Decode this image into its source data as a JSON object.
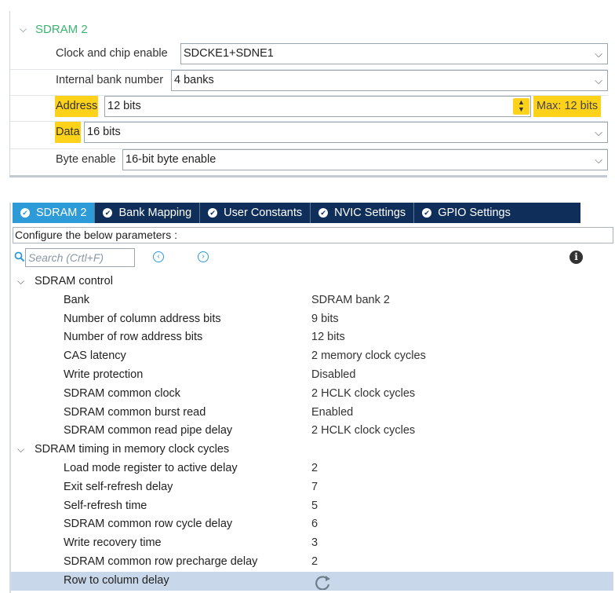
{
  "top_panel": {
    "group_title": "SDRAM 2",
    "rows": {
      "clock_chip_enable": {
        "label": "Clock and chip enable",
        "value": "SDCKE1+SDNE1"
      },
      "internal_bank_number": {
        "label": "Internal bank number",
        "value": "4 banks"
      },
      "address": {
        "label": "Address",
        "value": "12 bits",
        "max": "Max: 12 bits"
      },
      "data": {
        "label": "Data",
        "value": "16 bits"
      },
      "byte_enable": {
        "label": "Byte enable",
        "value": "16-bit byte enable"
      }
    },
    "highlight_color": "#ffd21a"
  },
  "tabs": [
    {
      "label": "SDRAM 2",
      "active": true
    },
    {
      "label": "Bank Mapping",
      "active": false
    },
    {
      "label": "User Constants",
      "active": false
    },
    {
      "label": "NVIC Settings",
      "active": false
    },
    {
      "label": "GPIO Settings",
      "active": false
    }
  ],
  "config_bar": "Configure the below parameters :",
  "search": {
    "placeholder": "Search (Crtl+F)"
  },
  "sections": {
    "control": {
      "title": "SDRAM control",
      "params": [
        {
          "name": "Bank",
          "value": "SDRAM bank 2"
        },
        {
          "name": "Number of column address bits",
          "value": "9 bits"
        },
        {
          "name": "Number of row address bits",
          "value": "12 bits"
        },
        {
          "name": "CAS latency",
          "value": "2 memory clock cycles"
        },
        {
          "name": "Write protection",
          "value": "Disabled"
        },
        {
          "name": "SDRAM common clock",
          "value": "2 HCLK clock cycles"
        },
        {
          "name": "SDRAM common burst read",
          "value": "Enabled"
        },
        {
          "name": "SDRAM common read pipe delay",
          "value": "2 HCLK clock cycles"
        }
      ]
    },
    "timing": {
      "title": "SDRAM timing in memory clock cycles",
      "params": [
        {
          "name": "Load mode register to active delay",
          "value": "2"
        },
        {
          "name": "Exit self-refresh delay",
          "value": "7"
        },
        {
          "name": "Self-refresh time",
          "value": "5"
        },
        {
          "name": "SDRAM common row cycle delay",
          "value": "6"
        },
        {
          "name": "Write recovery time",
          "value": "3"
        },
        {
          "name": "SDRAM common row precharge delay",
          "value": "2"
        },
        {
          "name": "Row to column delay",
          "value": ""
        }
      ]
    }
  },
  "colors": {
    "tab_bar": "#0f2f5a",
    "tab_active": "#2d9bd8",
    "group_title": "#3cb371",
    "selected_row": "#c8d8ea"
  }
}
